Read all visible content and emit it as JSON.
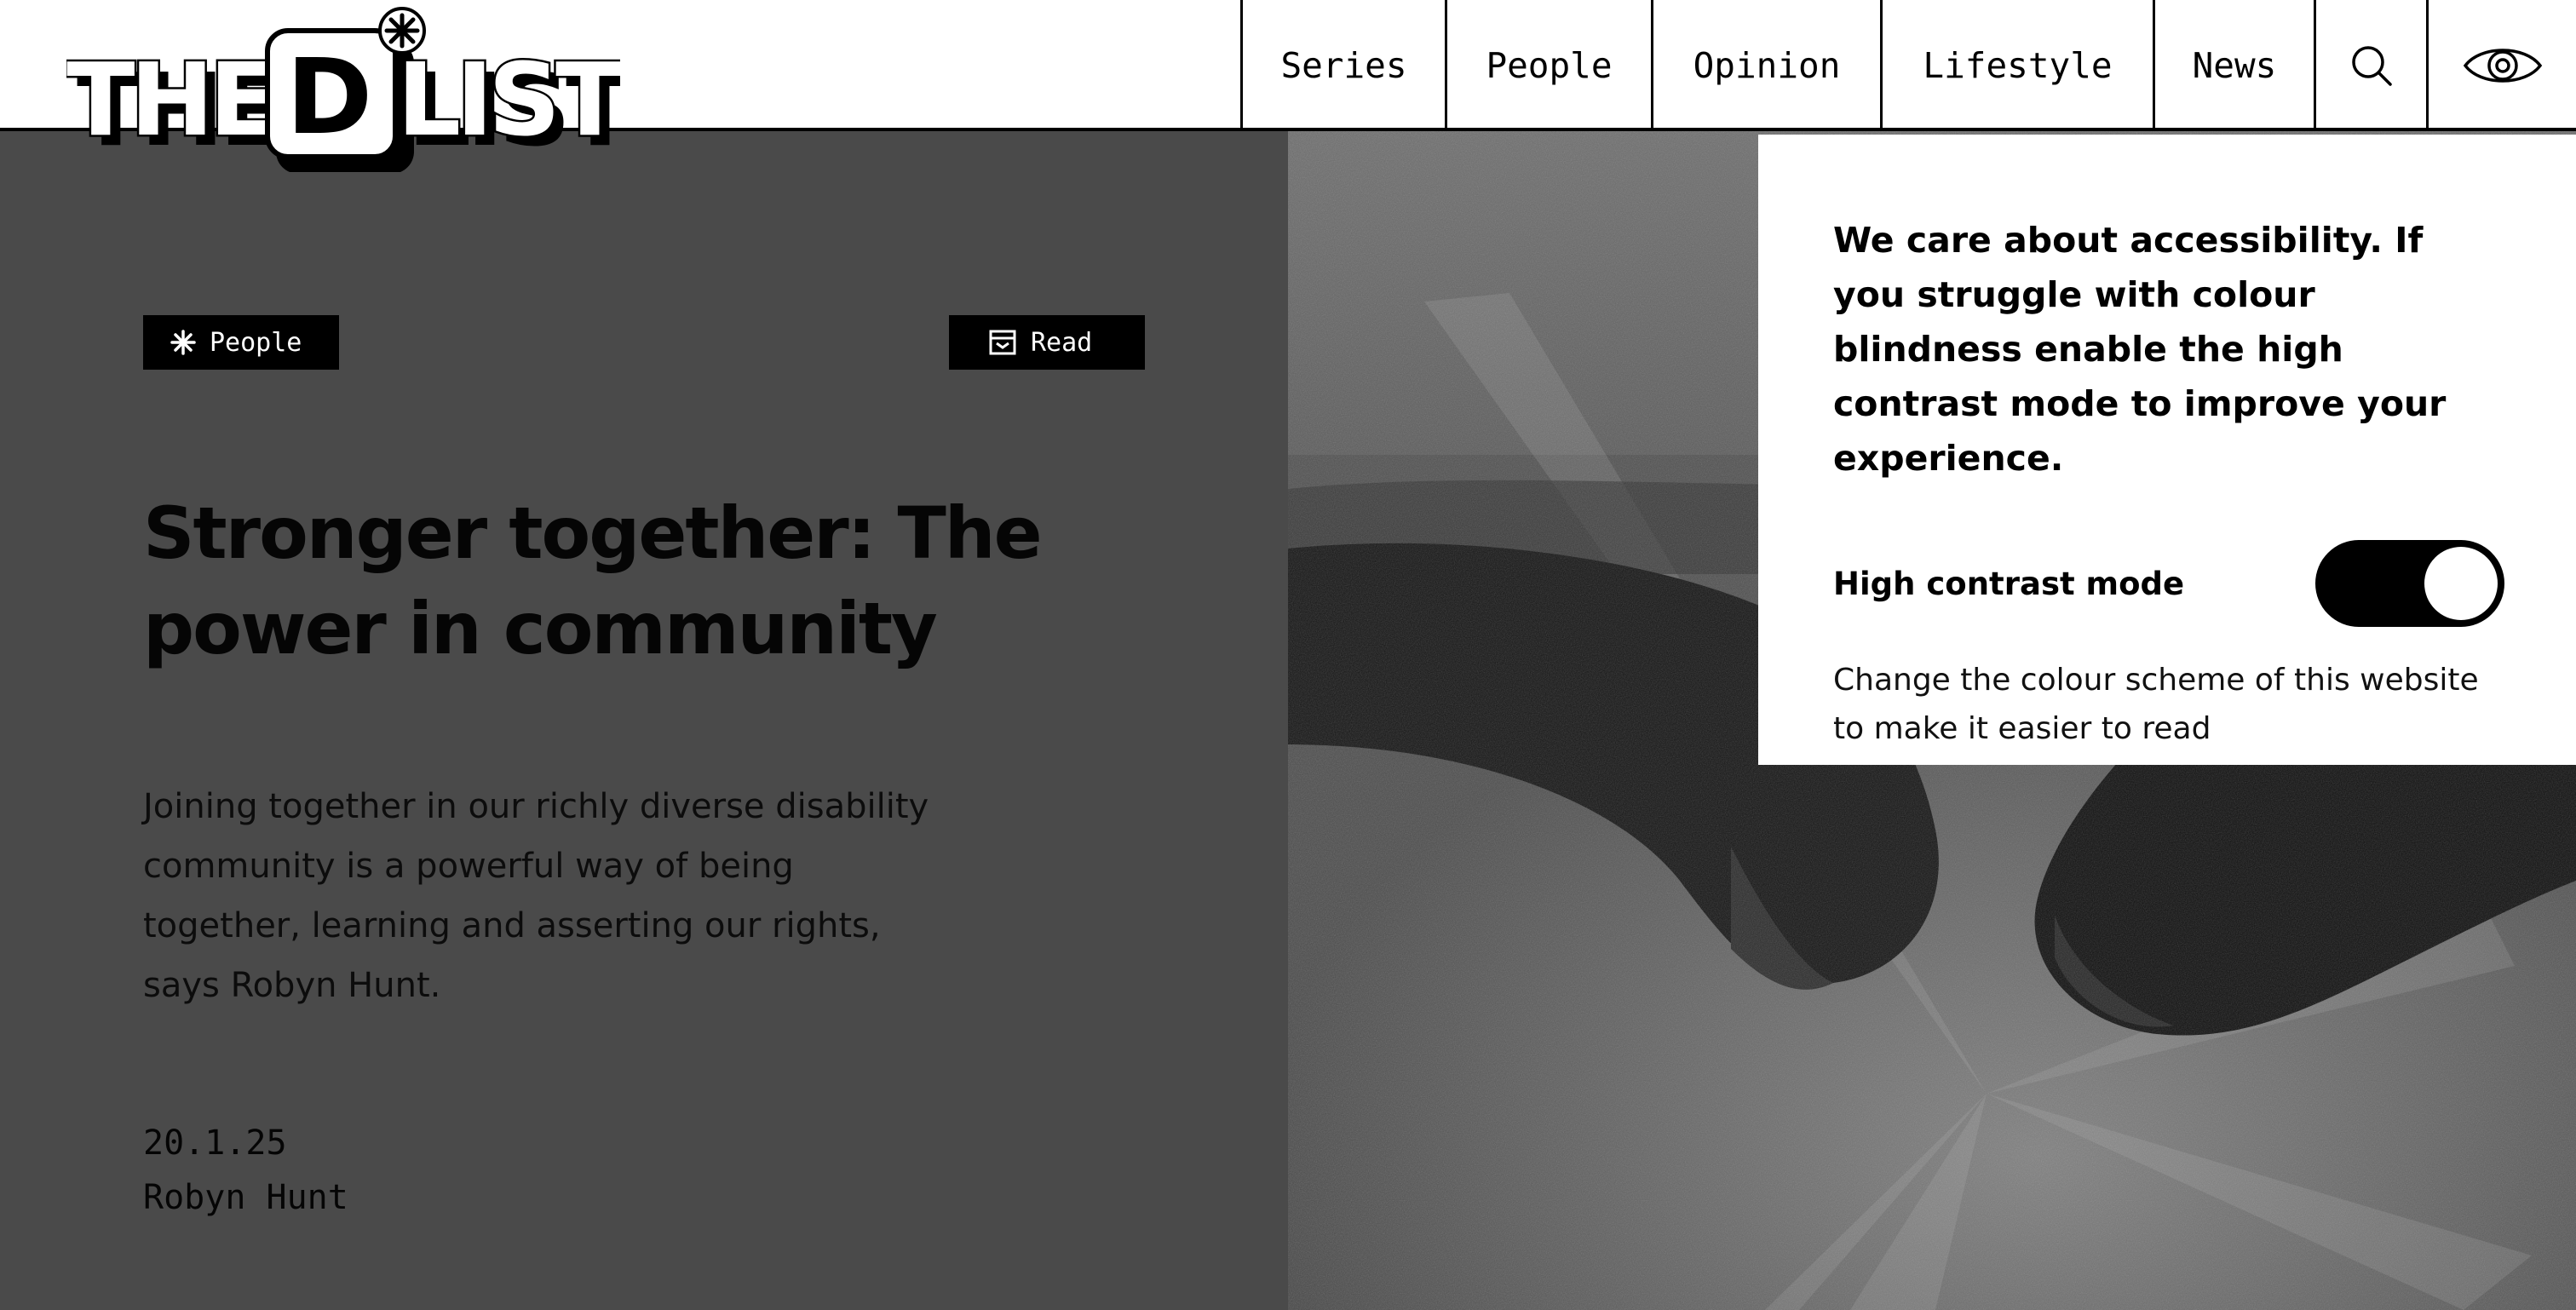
{
  "brand": {
    "logo_text": "THE D LIST"
  },
  "nav": {
    "items": [
      "Series",
      "People",
      "Opinion",
      "Lifestyle",
      "News"
    ],
    "search_icon": "search-icon",
    "contrast_icon": "eye-icon"
  },
  "article": {
    "category_tag": "People",
    "category_icon": "asterisk-icon",
    "format_tag": "Read",
    "format_icon": "book-icon",
    "headline_line1": "Stronger together: The",
    "headline_line2": "power in community",
    "standfirst": "Joining together in our richly diverse disability community is a powerful way of being together, learning and asserting our rights, says Robyn Hunt.",
    "date": "20.1.25",
    "author": "Robyn Hunt"
  },
  "accessibility_popup": {
    "heading": "We care about accessibility. If you struggle with colour blindness enable the high contrast mode to improve your experience.",
    "toggle_label": "High contrast mode",
    "toggle_on": true,
    "description": "Change the colour scheme of this website to make it easier to read"
  },
  "colors": {
    "accent": "#000000",
    "panel": "#4a4a4a",
    "surface": "#ffffff"
  }
}
